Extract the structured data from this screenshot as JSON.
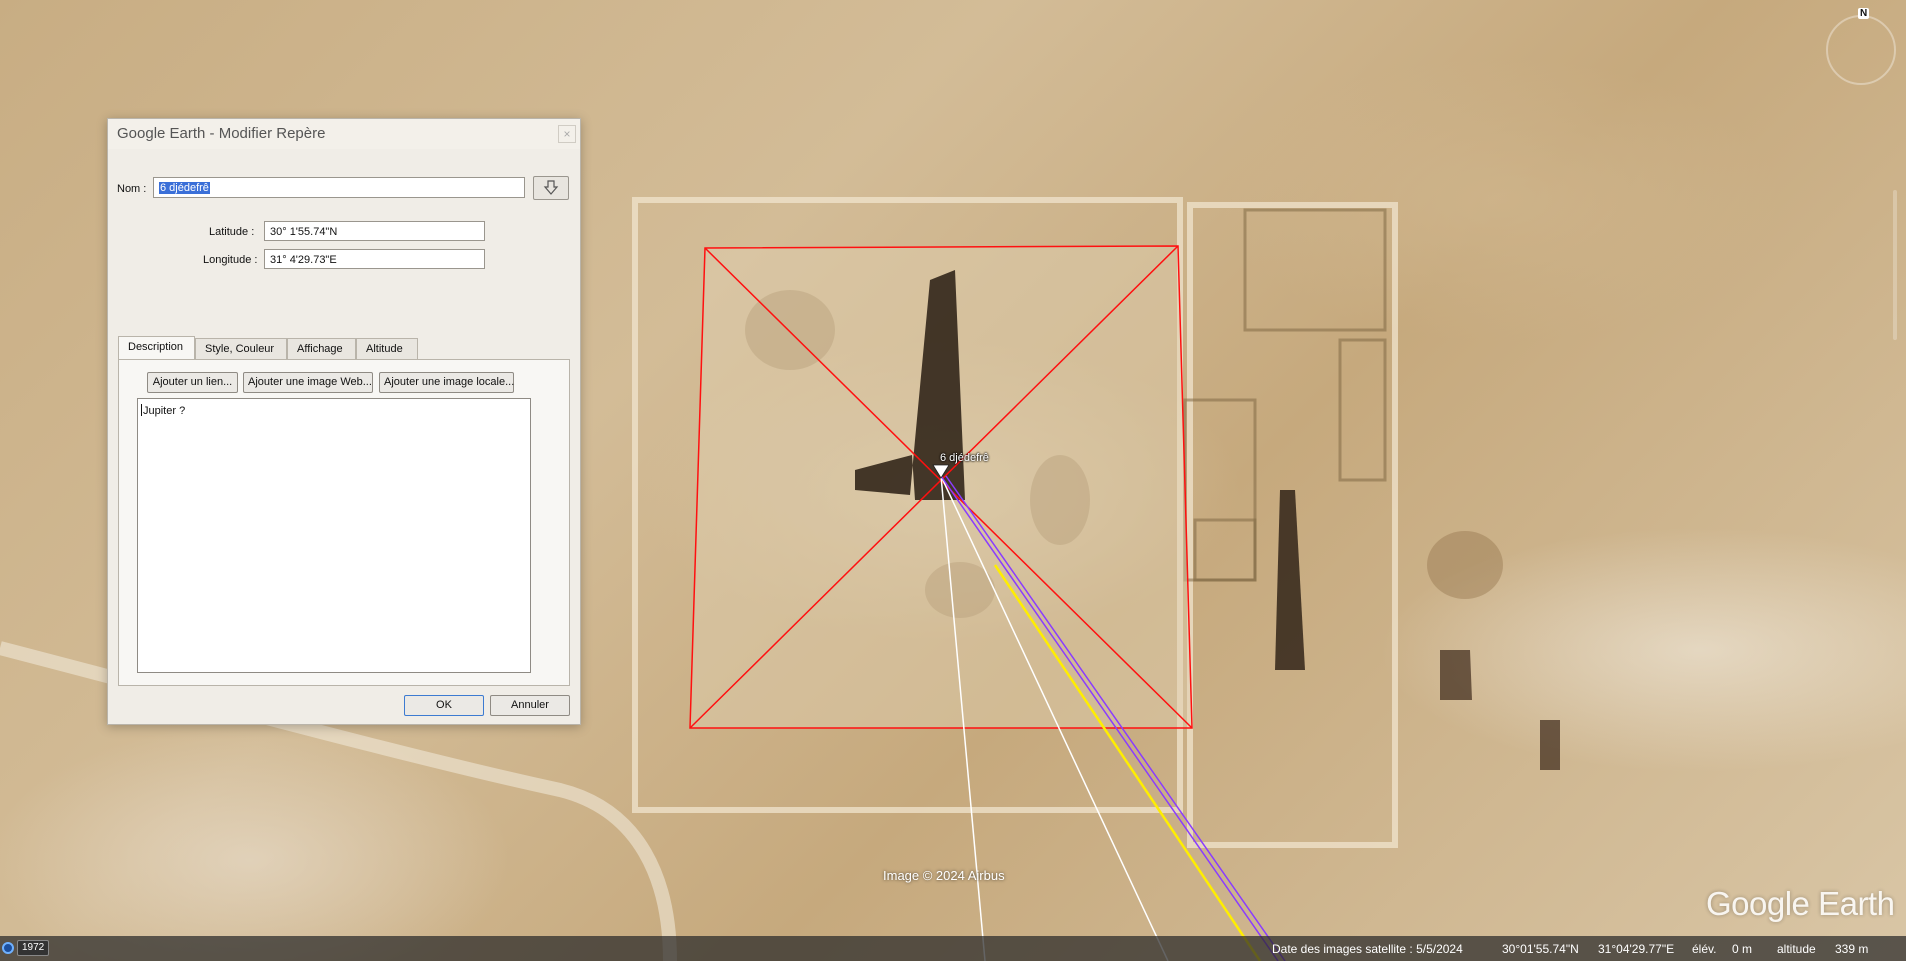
{
  "dialog": {
    "title": "Google Earth - Modifier Repère",
    "close_symbol": "×",
    "name_label": "Nom :",
    "name_value": "6 djédefrê",
    "latitude_label": "Latitude :",
    "latitude_value": "30° 1'55.74\"N",
    "longitude_label": "Longitude :",
    "longitude_value": "31° 4'29.73\"E",
    "icon_button": "pushpin-icon",
    "tabs": [
      "Description",
      "Style, Couleur",
      "Affichage",
      "Altitude"
    ],
    "active_tab": "Description",
    "buttons": {
      "add_link": "Ajouter un lien...",
      "add_web_image": "Ajouter une image Web...",
      "add_local_image": "Ajouter une image locale..."
    },
    "description_text": "Jupiter ?",
    "ok": "OK",
    "cancel": "Annuler"
  },
  "map": {
    "placemark_label": "6 djédefrê",
    "copyright": "Image © 2024 Airbus",
    "logo": "Google Earth",
    "compass_north": "N"
  },
  "statusbar": {
    "year": "1972",
    "imagery_date": "Date des images satellite : 5/5/2024",
    "lat": "30°01'55.74\"N",
    "lon": "31°04'29.77\"E",
    "elev_label": "élév.",
    "elev_value": "0 m",
    "altitude_label": "altitude",
    "altitude_value": "339 m"
  },
  "colors": {
    "overlay_line": "#ff1010",
    "path_purple": "#8a3cff",
    "path_yellow": "#ffee00",
    "path_white": "#ffffff",
    "selection": "#3a6fd8"
  }
}
